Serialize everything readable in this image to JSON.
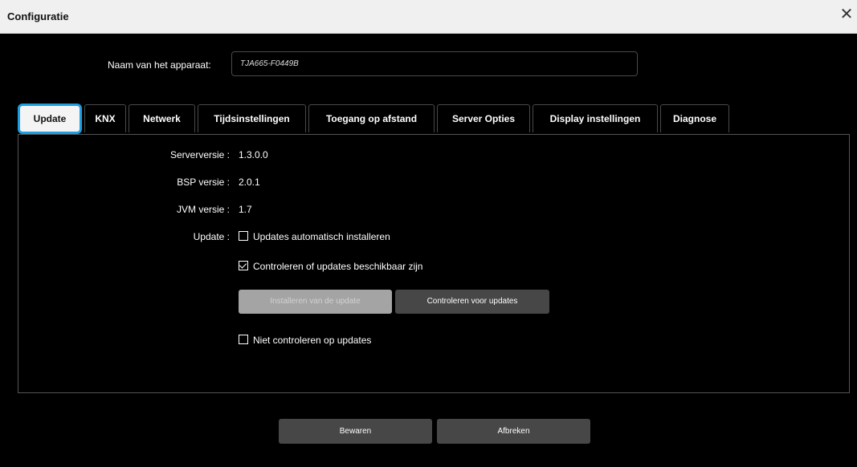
{
  "window": {
    "title": "Configuratie",
    "close_symbol": "✕"
  },
  "device": {
    "label": "Naam van het apparaat:",
    "value": "TJA665-F0449B"
  },
  "tabs": [
    {
      "label": "Update",
      "active": true
    },
    {
      "label": "KNX"
    },
    {
      "label": "Netwerk"
    },
    {
      "label": "Tijdsinstellingen"
    },
    {
      "label": "Toegang op afstand"
    },
    {
      "label": "Server Opties"
    },
    {
      "label": "Display instellingen"
    },
    {
      "label": "Diagnose"
    }
  ],
  "update": {
    "server_label": "Serverversie :",
    "server_value": "1.3.0.0",
    "bsp_label": "BSP versie :",
    "bsp_value": "2.0.1",
    "jvm_label": "JVM versie :",
    "jvm_value": "1.7",
    "update_label": "Update :",
    "auto_install": {
      "label": "Updates automatisch installeren",
      "checked": false
    },
    "check_available": {
      "label": "Controleren of updates beschikbaar zijn",
      "checked": true
    },
    "install_button": "Installeren van de update",
    "check_button": "Controleren voor updates",
    "no_check": {
      "label": "Niet controleren op updates",
      "checked": false
    }
  },
  "footer": {
    "save": "Bewaren",
    "cancel": "Afbreken"
  },
  "colors": {
    "accent": "#1e9de0",
    "background": "#000000",
    "titlebar": "#f0f0f0"
  }
}
